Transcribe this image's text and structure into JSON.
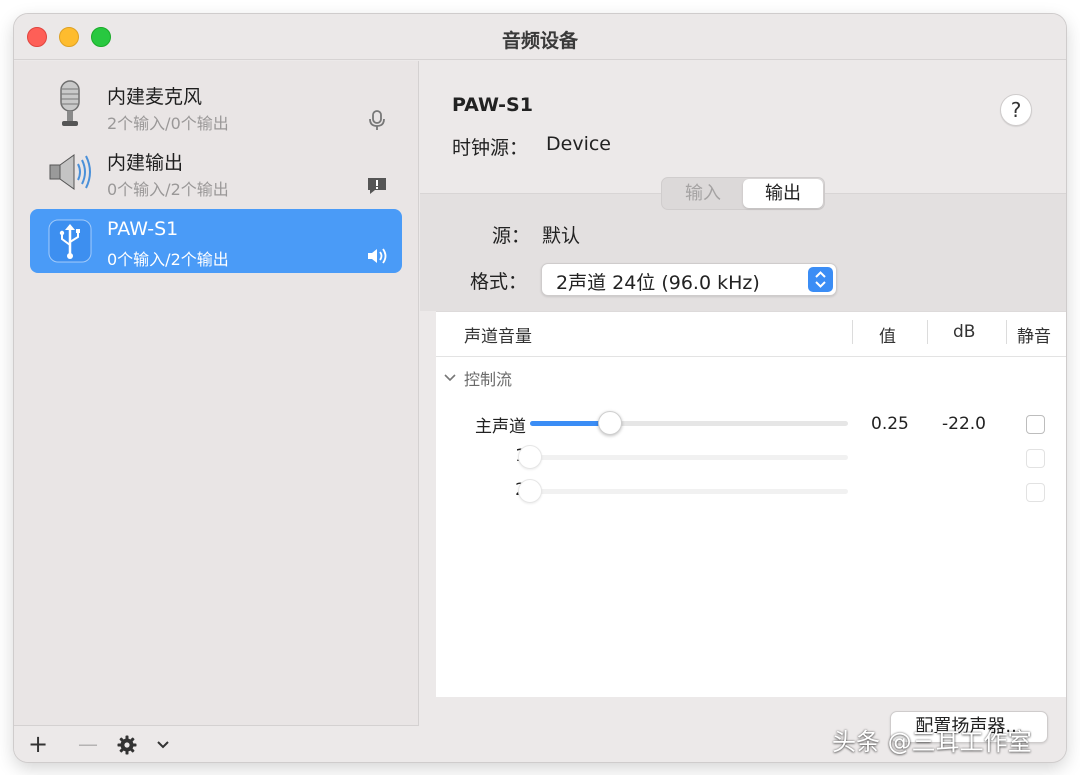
{
  "window": {
    "title": "音频设备"
  },
  "sidebar": {
    "devices": [
      {
        "name": "内建麦克风",
        "io": "2个输入/0个输出",
        "icon": "microphone-icon",
        "badge": "mic-badge-icon"
      },
      {
        "name": "内建输出",
        "io": "0个输入/2个输出",
        "icon": "speaker-icon",
        "badge": "alert-bubble-icon"
      },
      {
        "name": "PAW-S1",
        "io": "0个输入/2个输出",
        "icon": "usb-icon",
        "badge": "volume-icon",
        "selected": true
      }
    ],
    "footer": {
      "add": "+",
      "remove": "—"
    }
  },
  "main": {
    "device_title": "PAW-S1",
    "clock_label": "时钟源：",
    "clock_value": "Device",
    "help": "?",
    "tabs": [
      {
        "label": "输入"
      },
      {
        "label": "输出",
        "selected": true
      }
    ],
    "source_label": "源：",
    "source_value": "默认",
    "format_label": "格式：",
    "format_value": "2声道 24位 (96.0 kHz)",
    "table": {
      "headers": {
        "channel": "声道音量",
        "value": "值",
        "db": "dB",
        "mute": "静音"
      },
      "group": "控制流",
      "rows": [
        {
          "label": "主声道",
          "level": 0.25,
          "value": "0.25",
          "db": "-22.0",
          "muted": false
        },
        {
          "label": "1",
          "level": 0,
          "value": "",
          "db": "",
          "muted": false
        },
        {
          "label": "2",
          "level": 0,
          "value": "",
          "db": "",
          "muted": false
        }
      ]
    },
    "configure_button": "配置扬声器..."
  },
  "watermark": "头条 @三耳工作室",
  "colors": {
    "accent": "#3b8df5",
    "selection": "#4a9bf7"
  }
}
